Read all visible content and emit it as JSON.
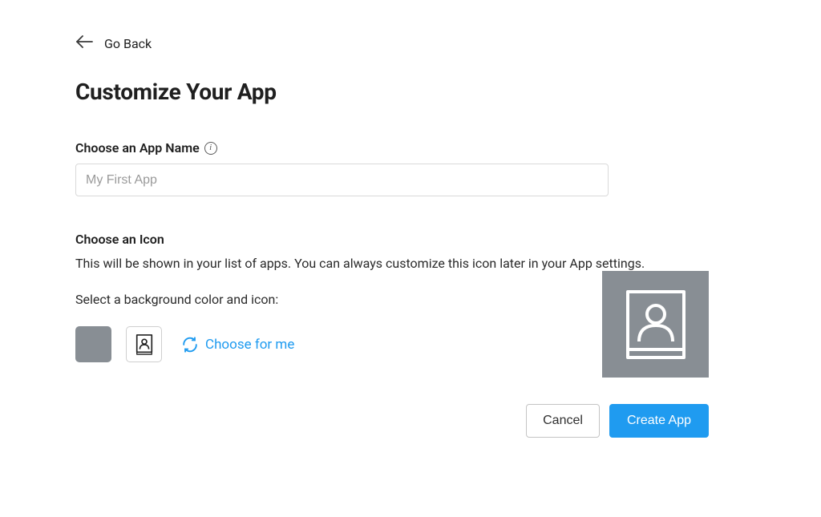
{
  "nav": {
    "back_label": "Go Back"
  },
  "page": {
    "title": "Customize Your App"
  },
  "name_field": {
    "label": "Choose an App Name",
    "placeholder": "My First App",
    "value": ""
  },
  "icon_section": {
    "title": "Choose an Icon",
    "description": "This will be shown in your list of apps. You can always customize this icon later in your App settings.",
    "helper": "Select a background color and icon:",
    "choose_label": "Choose for me",
    "selected_color": "#888e94",
    "selected_icon": "contact-book-icon"
  },
  "buttons": {
    "cancel": "Cancel",
    "create": "Create App"
  },
  "colors": {
    "accent": "#1f9bf0",
    "swatch_gray": "#888e94"
  }
}
